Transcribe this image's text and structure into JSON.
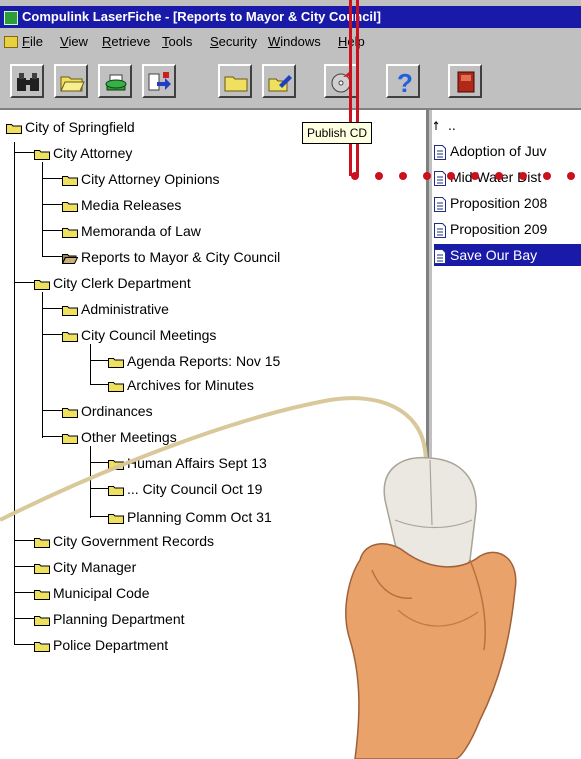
{
  "window": {
    "title": "Compulink LaserFiche - [Reports to Mayor & City Council]"
  },
  "menu": {
    "items": [
      "File",
      "View",
      "Retrieve",
      "Tools",
      "Security",
      "Windows",
      "Help"
    ]
  },
  "toolbar": {
    "buttons": [
      "binoculars-icon",
      "open-folder-icon",
      "print-icon",
      "export-icon",
      "new-folder-icon",
      "folder-edit-icon",
      "publish-cd-icon",
      "help-icon",
      "exit-icon"
    ],
    "help_glyph": "?"
  },
  "tooltip": {
    "text": "Publish CD"
  },
  "tree": {
    "nodes": [
      {
        "label": "City of Springfield"
      },
      {
        "label": "City Attorney"
      },
      {
        "label": "City Attorney Opinions"
      },
      {
        "label": "Media Releases"
      },
      {
        "label": "Memoranda of Law"
      },
      {
        "label": "Reports to Mayor & City Council"
      },
      {
        "label": "City Clerk Department"
      },
      {
        "label": "Administrative"
      },
      {
        "label": "City Council Meetings"
      },
      {
        "label": "Agenda Reports: Nov 15"
      },
      {
        "label": "Archives for Minutes"
      },
      {
        "label": "Ordinances"
      },
      {
        "label": "Other Meetings"
      },
      {
        "label": "Human Affairs Sept 13"
      },
      {
        "label": "... City Council Oct 19"
      },
      {
        "label": "Planning Comm Oct 31"
      },
      {
        "label": "City Government Records"
      },
      {
        "label": "City Manager"
      },
      {
        "label": "Municipal Code"
      },
      {
        "label": "Planning Department"
      },
      {
        "label": "Police Department"
      }
    ]
  },
  "list": {
    "up_label": "..",
    "items": [
      {
        "label": "Adoption of Juv"
      },
      {
        "label": "Mid Water Dist"
      },
      {
        "label": "Proposition 208"
      },
      {
        "label": "Proposition 209"
      },
      {
        "label": "Save Our Bay"
      }
    ]
  },
  "colors": {
    "titlebar": "#1a1aa8",
    "folder": "#f0e060",
    "selection": "#1a1aa8",
    "cord": "#cc1020"
  }
}
